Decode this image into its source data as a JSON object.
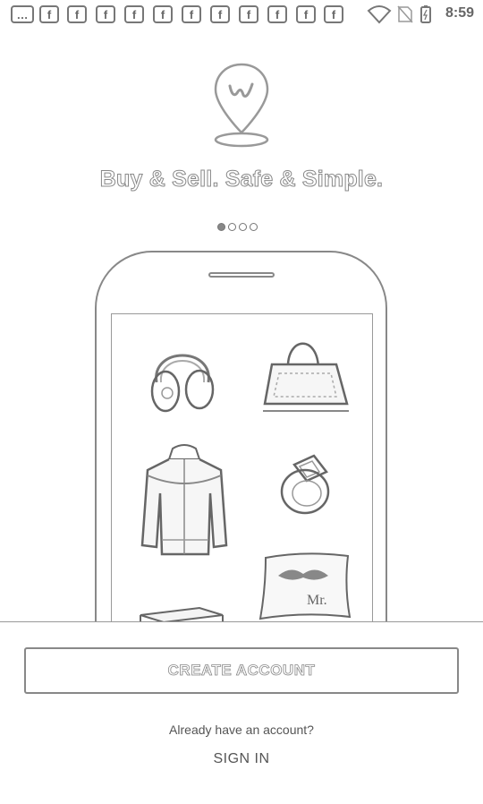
{
  "status_bar": {
    "time": "8:59",
    "notification_icons": [
      "chat-icon",
      "facebook-icon",
      "facebook-icon",
      "facebook-icon",
      "facebook-icon",
      "facebook-icon",
      "facebook-icon",
      "facebook-icon",
      "facebook-icon",
      "facebook-icon",
      "facebook-icon",
      "facebook-icon"
    ],
    "facebook_glyph": "f",
    "system_icons": [
      "wifi-icon",
      "no-sim-icon",
      "battery-icon"
    ]
  },
  "onboarding": {
    "tagline": "Buy & Sell. Safe & Simple.",
    "page_count": 4,
    "active_page": 1
  },
  "showcase": {
    "products": [
      "headphones-icon",
      "handbag-icon",
      "jacket-icon",
      "ring-icon",
      "pillow-icon",
      "book-icon"
    ],
    "pillow_text": "Mr."
  },
  "actions": {
    "create_account": "CREATE ACCOUNT",
    "already_text": "Already have an account?",
    "sign_in": "SIGN IN"
  }
}
